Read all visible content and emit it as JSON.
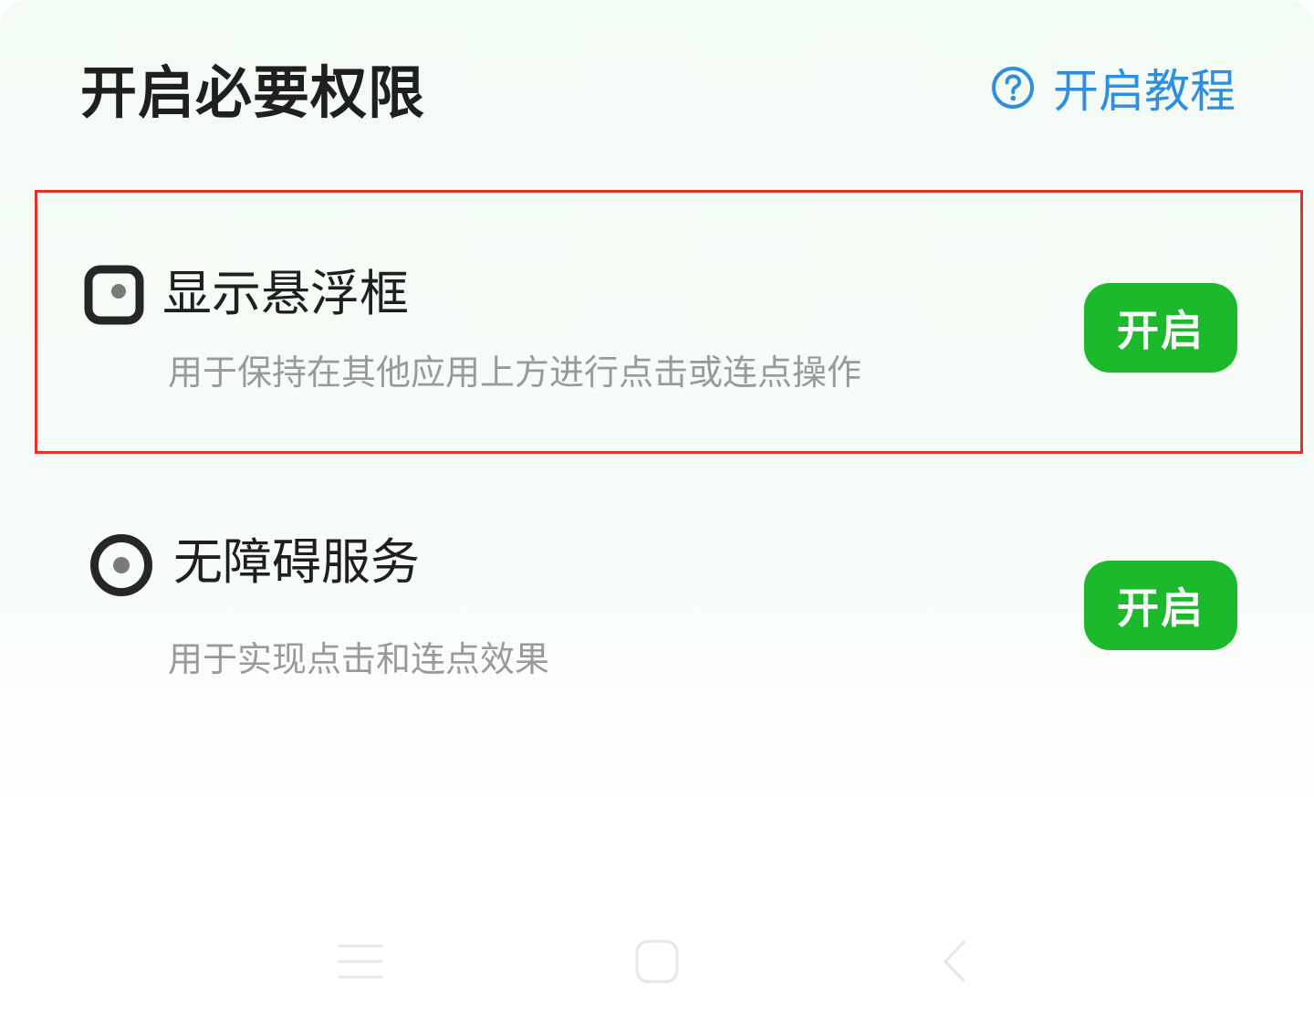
{
  "header": {
    "title": "开启必要权限",
    "tutorial_label": "开启教程",
    "tutorial_icon": "help-circle-icon",
    "accent_color": "#2e8ee0"
  },
  "permissions": [
    {
      "name": "显示悬浮框",
      "description": "用于保持在其他应用上方进行点击或连点操作",
      "button_label": "开启",
      "icon": "floating-window-icon",
      "highlighted": true
    },
    {
      "name": "无障碍服务",
      "description": "用于实现点击和连点效果",
      "button_label": "开启",
      "icon": "accessibility-service-icon",
      "highlighted": false
    }
  ],
  "colors": {
    "button_green": "#1db92d",
    "highlight_border": "#e0322b",
    "description_gray": "#9a9a9a"
  },
  "navigation": {
    "items": [
      "menu-icon",
      "home-icon",
      "back-icon"
    ]
  }
}
